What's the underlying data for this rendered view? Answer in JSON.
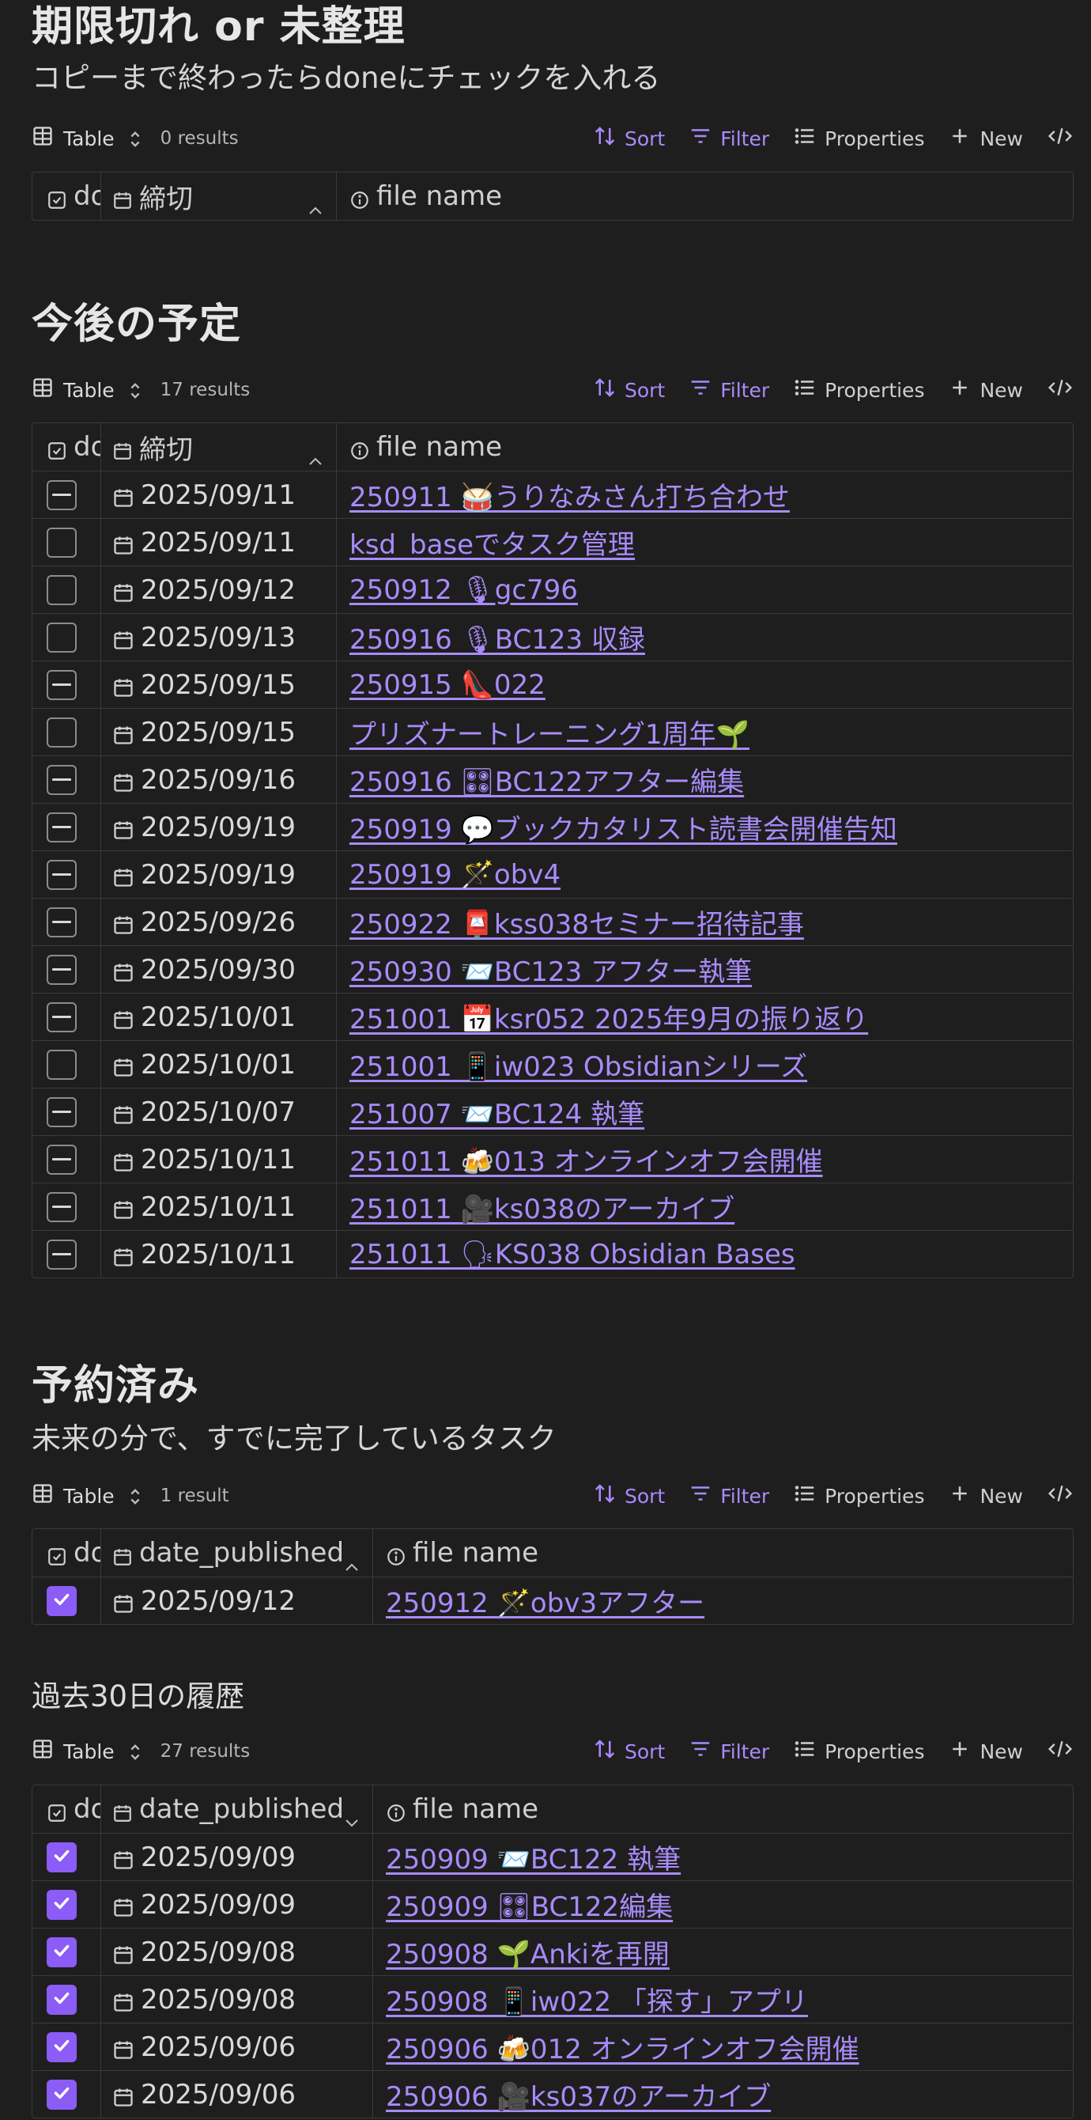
{
  "ui": {
    "toolbar": {
      "view_label": "Table",
      "sort": "Sort",
      "filter": "Filter",
      "properties": "Properties",
      "new": "New"
    },
    "accent": "#a88bfa"
  },
  "sections": [
    {
      "title": "期限切れ or 未整理",
      "description": "コピーまで終わったらdoneにチェックを入れる",
      "result_count": "0 results",
      "columns": {
        "done": "done",
        "date": "締切",
        "file": "file name"
      },
      "rows": []
    },
    {
      "title": "今後の予定",
      "result_count": "17 results",
      "columns": {
        "done": "done",
        "date": "締切",
        "file": "file name"
      },
      "rows": [
        {
          "state": "indeterminate",
          "date": "2025/09/11",
          "file": "250911 🥁うりなみさん打ち合わせ"
        },
        {
          "state": "unchecked",
          "date": "2025/09/11",
          "file": "ksd_baseでタスク管理"
        },
        {
          "state": "unchecked",
          "date": "2025/09/12",
          "file": "250912 🎙gc796"
        },
        {
          "state": "unchecked",
          "date": "2025/09/13",
          "file": "250916 🎙BC123 収録"
        },
        {
          "state": "indeterminate",
          "date": "2025/09/15",
          "file": "250915 👠022"
        },
        {
          "state": "unchecked",
          "date": "2025/09/15",
          "file": "プリズナートレーニング1周年🌱"
        },
        {
          "state": "indeterminate",
          "date": "2025/09/16",
          "file": "250916 🎛BC122アフター編集"
        },
        {
          "state": "indeterminate",
          "date": "2025/09/19",
          "file": "250919 💬ブックカタリスト読書会開催告知"
        },
        {
          "state": "indeterminate",
          "date": "2025/09/19",
          "file": "250919 🪄obv4"
        },
        {
          "state": "indeterminate",
          "date": "2025/09/26",
          "file": "250922 📮kss038セミナー招待記事"
        },
        {
          "state": "indeterminate",
          "date": "2025/09/30",
          "file": "250930 📨BC123 アフター執筆"
        },
        {
          "state": "indeterminate",
          "date": "2025/10/01",
          "file": "251001 📅ksr052 2025年9月の振り返り"
        },
        {
          "state": "unchecked",
          "date": "2025/10/01",
          "file": "251001 📱iw023 Obsidianシリーズ"
        },
        {
          "state": "indeterminate",
          "date": "2025/10/07",
          "file": "251007 📨BC124 執筆"
        },
        {
          "state": "indeterminate",
          "date": "2025/10/11",
          "file": "251011 🍻013 オンラインオフ会開催"
        },
        {
          "state": "indeterminate",
          "date": "2025/10/11",
          "file": "251011 🎥ks038のアーカイブ"
        },
        {
          "state": "indeterminate",
          "date": "2025/10/11",
          "file": "251011 🗣KS038 Obsidian Bases"
        }
      ]
    },
    {
      "title": "予約済み",
      "description": "未来の分で、すでに完了しているタスク",
      "result_count": "1 result",
      "columns": {
        "done": "done",
        "date": "date_published",
        "file": "file name"
      },
      "rows": [
        {
          "state": "checked",
          "date": "2025/09/12",
          "file": "250912 🪄obv3アフター"
        }
      ]
    },
    {
      "title": "過去30日の履歴",
      "result_count": "27 results",
      "columns": {
        "done": "done",
        "date": "date_published",
        "file": "file name"
      },
      "rows": [
        {
          "state": "checked",
          "date": "2025/09/09",
          "file": "250909 📨BC122 執筆"
        },
        {
          "state": "checked",
          "date": "2025/09/09",
          "file": "250909 🎛BC122編集"
        },
        {
          "state": "checked",
          "date": "2025/09/08",
          "file": "250908 🌱Ankiを再開"
        },
        {
          "state": "checked",
          "date": "2025/09/08",
          "file": "250908 📱iw022 「探す」アプリ"
        },
        {
          "state": "checked",
          "date": "2025/09/06",
          "file": "250906 🍻012 オンラインオフ会開催"
        },
        {
          "state": "checked",
          "date": "2025/09/06",
          "file": "250906 🎥ks037のアーカイブ"
        }
      ]
    }
  ]
}
